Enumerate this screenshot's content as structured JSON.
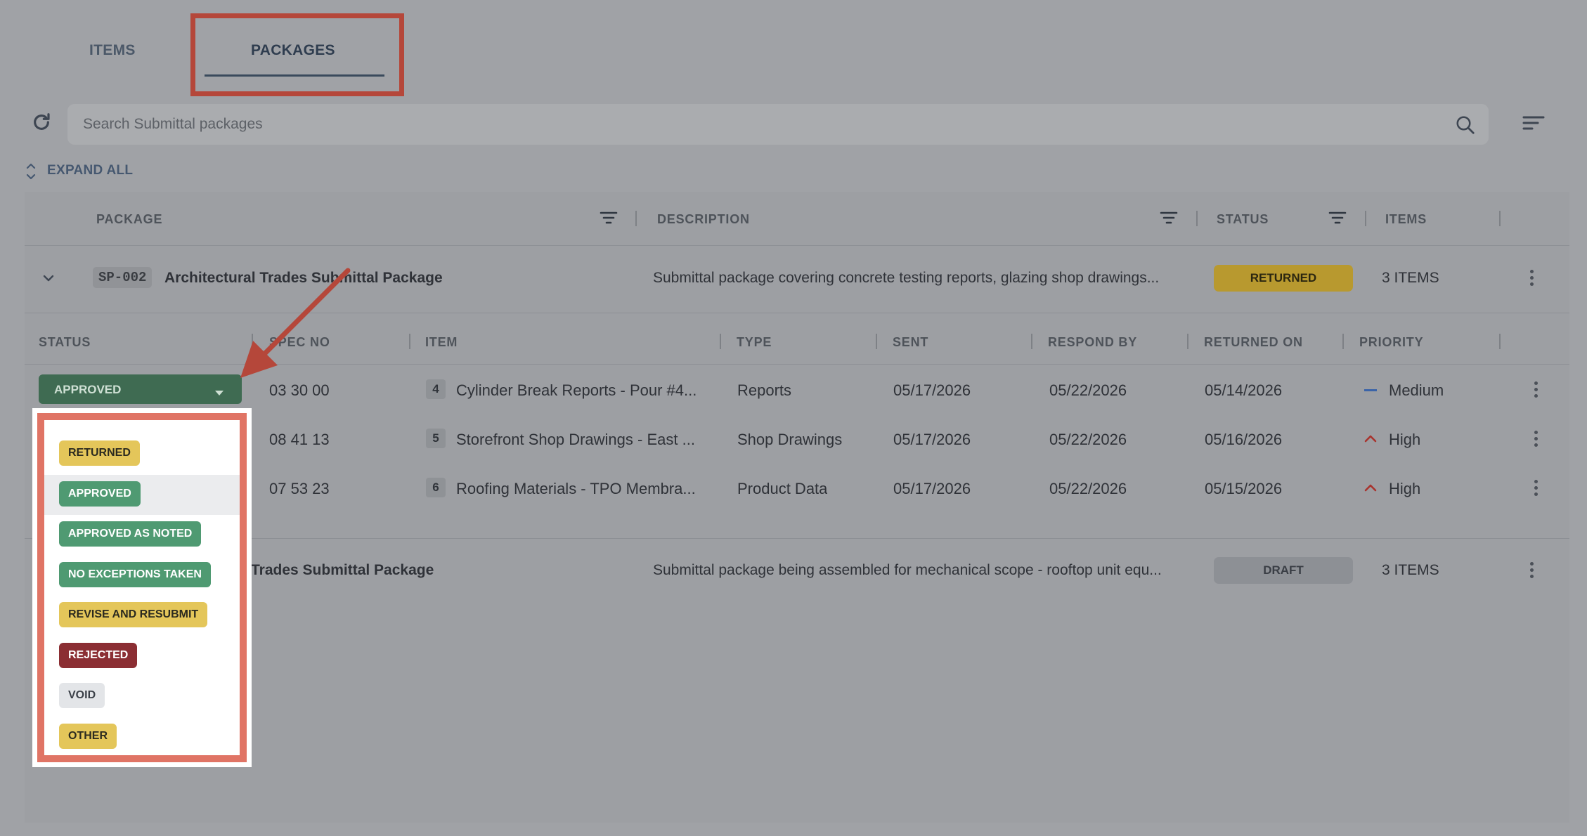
{
  "tabs": [
    {
      "label": "ITEMS"
    },
    {
      "label": "PACKAGES"
    }
  ],
  "search": {
    "placeholder": "Search Submittal packages"
  },
  "expand_all": "EXPAND ALL",
  "columns": {
    "package": "PACKAGE",
    "description": "DESCRIPTION",
    "status": "STATUS",
    "items": "ITEMS"
  },
  "packages": [
    {
      "id": "SP-002",
      "title": "Architectural Trades Submittal Package",
      "description": "Submittal package covering concrete testing reports, glazing shop drawings...",
      "status": "RETURNED",
      "items_count": "3 ITEMS"
    },
    {
      "id": "",
      "title": "Trades Submittal Package",
      "description": "Submittal package being assembled for mechanical scope - rooftop unit equ...",
      "status": "DRAFT",
      "items_count": "3 ITEMS"
    }
  ],
  "item_columns": {
    "status": "STATUS",
    "spec_no": "SPEC NO",
    "item": "ITEM",
    "type": "TYPE",
    "sent": "SENT",
    "respond_by": "RESPOND BY",
    "returned_on": "RETURNED ON",
    "priority": "PRIORITY"
  },
  "items": [
    {
      "status": "APPROVED",
      "spec_no": "03 30 00",
      "num": "4",
      "item": "Cylinder Break Reports - Pour #4...",
      "type": "Reports",
      "sent": "05/17/2026",
      "respond_by": "05/22/2026",
      "returned_on": "05/14/2026",
      "priority": "Medium"
    },
    {
      "status": "",
      "spec_no": "08 41 13",
      "num": "5",
      "item": "Storefront Shop Drawings - East ...",
      "type": "Shop Drawings",
      "sent": "05/17/2026",
      "respond_by": "05/22/2026",
      "returned_on": "05/16/2026",
      "priority": "High"
    },
    {
      "status": "",
      "spec_no": "07 53 23",
      "num": "6",
      "item": "Roofing Materials - TPO Membra...",
      "type": "Product Data",
      "sent": "05/17/2026",
      "respond_by": "05/22/2026",
      "returned_on": "05/15/2026",
      "priority": "High"
    }
  ],
  "status_options": [
    {
      "label": "RETURNED",
      "bg": "#e4c65a",
      "fg": "#2b2a1f"
    },
    {
      "label": "APPROVED",
      "bg": "#4f9a72",
      "fg": "#ffffff"
    },
    {
      "label": "APPROVED AS NOTED",
      "bg": "#4f9a72",
      "fg": "#ffffff"
    },
    {
      "label": "NO EXCEPTIONS TAKEN",
      "bg": "#4f9a72",
      "fg": "#ffffff"
    },
    {
      "label": "REVISE AND RESUBMIT",
      "bg": "#e4c65a",
      "fg": "#2b2a1f"
    },
    {
      "label": "REJECTED",
      "bg": "#8b2e33",
      "fg": "#ffffff"
    },
    {
      "label": "VOID",
      "bg": "#e3e5e8",
      "fg": "#3b4048"
    },
    {
      "label": "OTHER",
      "bg": "#e4c65a",
      "fg": "#2b2a1f"
    }
  ],
  "colors": {
    "returned": "#b8992f",
    "draft": "#8d9095",
    "approved_select": "#3f6b52",
    "highlight_box": "#b5473a",
    "dropdown_border": "#e07465",
    "priority_medium": "#3b64a8",
    "priority_high": "#a8332d"
  }
}
